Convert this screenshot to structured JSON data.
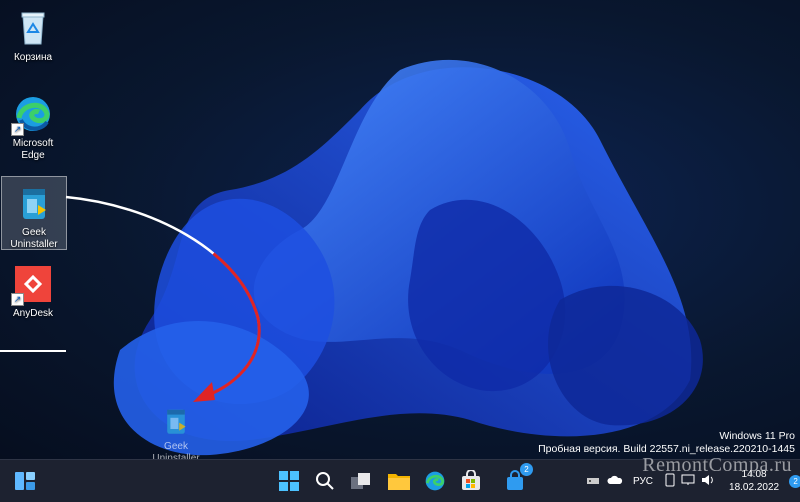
{
  "desktop": {
    "icons": [
      {
        "label": "Корзина",
        "icon": "recycle-bin-icon"
      },
      {
        "label": "Microsoft Edge",
        "icon": "edge-icon"
      },
      {
        "label": "Geek Uninstaller",
        "icon": "geek-uninstaller-icon"
      },
      {
        "label": "AnyDesk",
        "icon": "anydesk-icon"
      }
    ],
    "drag_ghost_label": "Geek Uninstaller"
  },
  "system_info": {
    "os": "Windows 11 Pro",
    "build": "Пробная версия. Build 22557.ni_release.220210-1445"
  },
  "taskbar": {
    "store_badge": "2",
    "language": "РУС",
    "time": "14:08",
    "date": "18.02.2022",
    "notification_count": "2"
  },
  "watermark": "RemontCompa.ru",
  "colors": {
    "accent": "#1e5be6",
    "arrow": "#e02424",
    "taskbar": "#1d2230"
  }
}
